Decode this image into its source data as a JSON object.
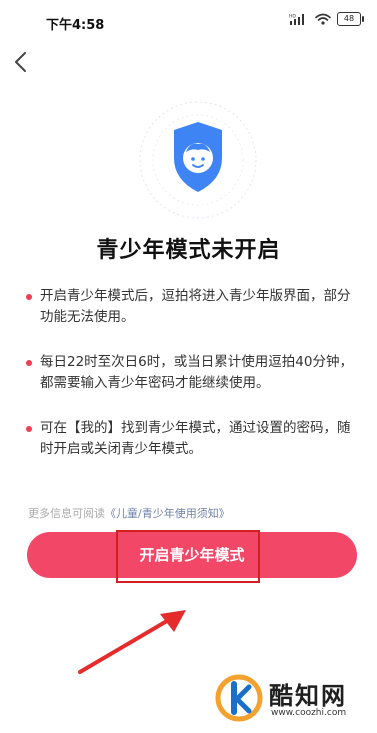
{
  "status_bar": {
    "time": "下午4:58",
    "network_label": "HD",
    "battery_level": "48",
    "icons": [
      "signal-icon",
      "wifi-icon",
      "battery-icon"
    ]
  },
  "nav": {
    "back_icon": "chevron-left-icon"
  },
  "hero": {
    "icon": "shield-child-face-icon",
    "color": "#3f84f5"
  },
  "page": {
    "title": "青少年模式未开启",
    "bullets": [
      "开启青少年模式后，逗拍将进入青少年版界面，部分功能无法使用。",
      "每日22时至次日6时，或当日累计使用逗拍40分钟，都需要输入青少年密码才能继续使用。",
      "可在【我的】找到青少年模式，通过设置的密码，随时开启或关闭青少年模式。"
    ],
    "more_info_prefix": "更多信息可阅读",
    "more_info_link": "《儿童/青少年使用须知》"
  },
  "action": {
    "button_label": "开启青少年模式"
  },
  "colors": {
    "accent": "#f24767",
    "bullet_dot": "#ef3e52",
    "highlight_box": "#d21f1f",
    "link": "#6e80a8"
  },
  "watermark": {
    "name": "酷知网",
    "url": "www.coozhi.com"
  }
}
